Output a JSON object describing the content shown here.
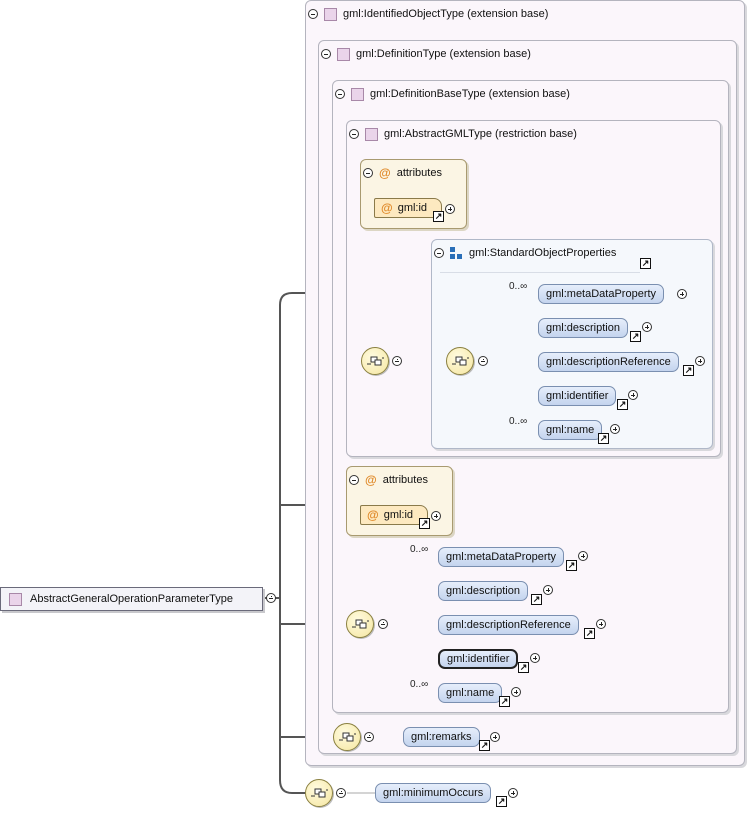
{
  "root": {
    "label": "AbstractGeneralOperationParameterType"
  },
  "boxes": {
    "identified": {
      "label": "gml:IdentifiedObjectType (extension base)"
    },
    "definition": {
      "label": "gml:DefinitionType (extension base)"
    },
    "definitionBase": {
      "label": "gml:DefinitionBaseType (extension base)"
    },
    "abstractGML": {
      "label": "gml:AbstractGMLType (restriction base)"
    }
  },
  "attributes": {
    "title": "attributes",
    "id_label": "gml:id"
  },
  "standardObjectProperties": {
    "label": "gml:StandardObjectProperties"
  },
  "occurrence": "0..∞",
  "sop_elements": [
    {
      "label": "gml:metaDataProperty"
    },
    {
      "label": "gml:description"
    },
    {
      "label": "gml:descriptionReference"
    },
    {
      "label": "gml:identifier"
    },
    {
      "label": "gml:name"
    }
  ],
  "def_elements": [
    {
      "label": "gml:metaDataProperty"
    },
    {
      "label": "gml:description"
    },
    {
      "label": "gml:descriptionReference"
    },
    {
      "label": "gml:identifier"
    },
    {
      "label": "gml:name"
    }
  ],
  "remarks": {
    "label": "gml:remarks"
  },
  "minimumOccurs": {
    "label": "gml:minimumOccurs"
  },
  "colors": {
    "element_fill": "#c4d4ee",
    "attribute_fill": "#fde9c0",
    "sequence_fill": "#f5e6a0",
    "complex_type_fill": "#ead4ea"
  }
}
